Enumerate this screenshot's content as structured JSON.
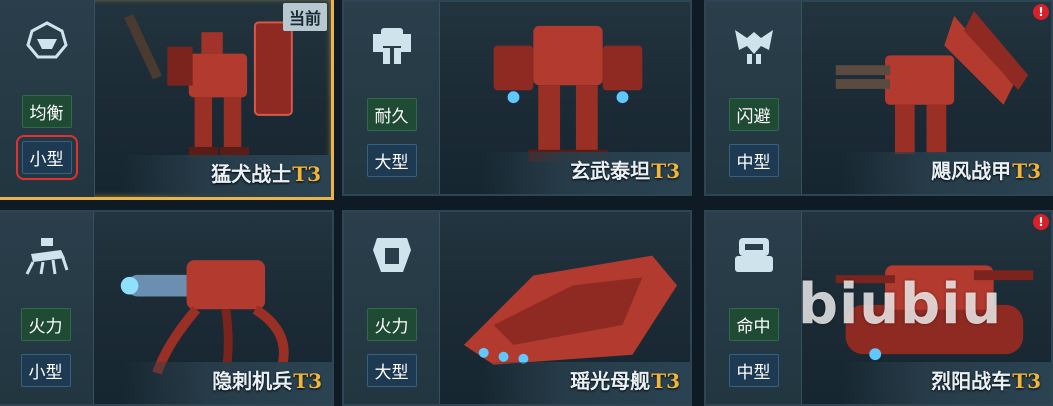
{
  "cards": [
    {
      "role": "均衡",
      "size": "小型",
      "name": "猛犬战士",
      "tier": "T3",
      "badge": "当前",
      "icon": "balanced-class-icon",
      "mech": "bipedal-mech",
      "color": "#b33a2e"
    },
    {
      "role": "耐久",
      "size": "大型",
      "name": "玄武泰坦",
      "tier": "T3",
      "icon": "heavy-class-icon",
      "mech": "titan-mech",
      "color": "#b33a2e"
    },
    {
      "role": "闪避",
      "size": "中型",
      "name": "飓风战甲",
      "tier": "T3",
      "alert": "!",
      "icon": "agile-class-icon",
      "mech": "winged-mech",
      "color": "#b33a2e"
    },
    {
      "role": "火力",
      "size": "小型",
      "name": "隐刺机兵",
      "tier": "T3",
      "icon": "spider-class-icon",
      "mech": "spider-mech",
      "color": "#b33a2e"
    },
    {
      "role": "火力",
      "size": "大型",
      "name": "瑶光母舰",
      "tier": "T3",
      "icon": "ship-class-icon",
      "mech": "mothership",
      "color": "#b33a2e"
    },
    {
      "role": "命中",
      "size": "中型",
      "name": "烈阳战车",
      "tier": "T3",
      "alert": "!",
      "icon": "tank-class-icon",
      "mech": "tank",
      "color": "#b33a2e"
    }
  ],
  "watermark": "biubiu"
}
